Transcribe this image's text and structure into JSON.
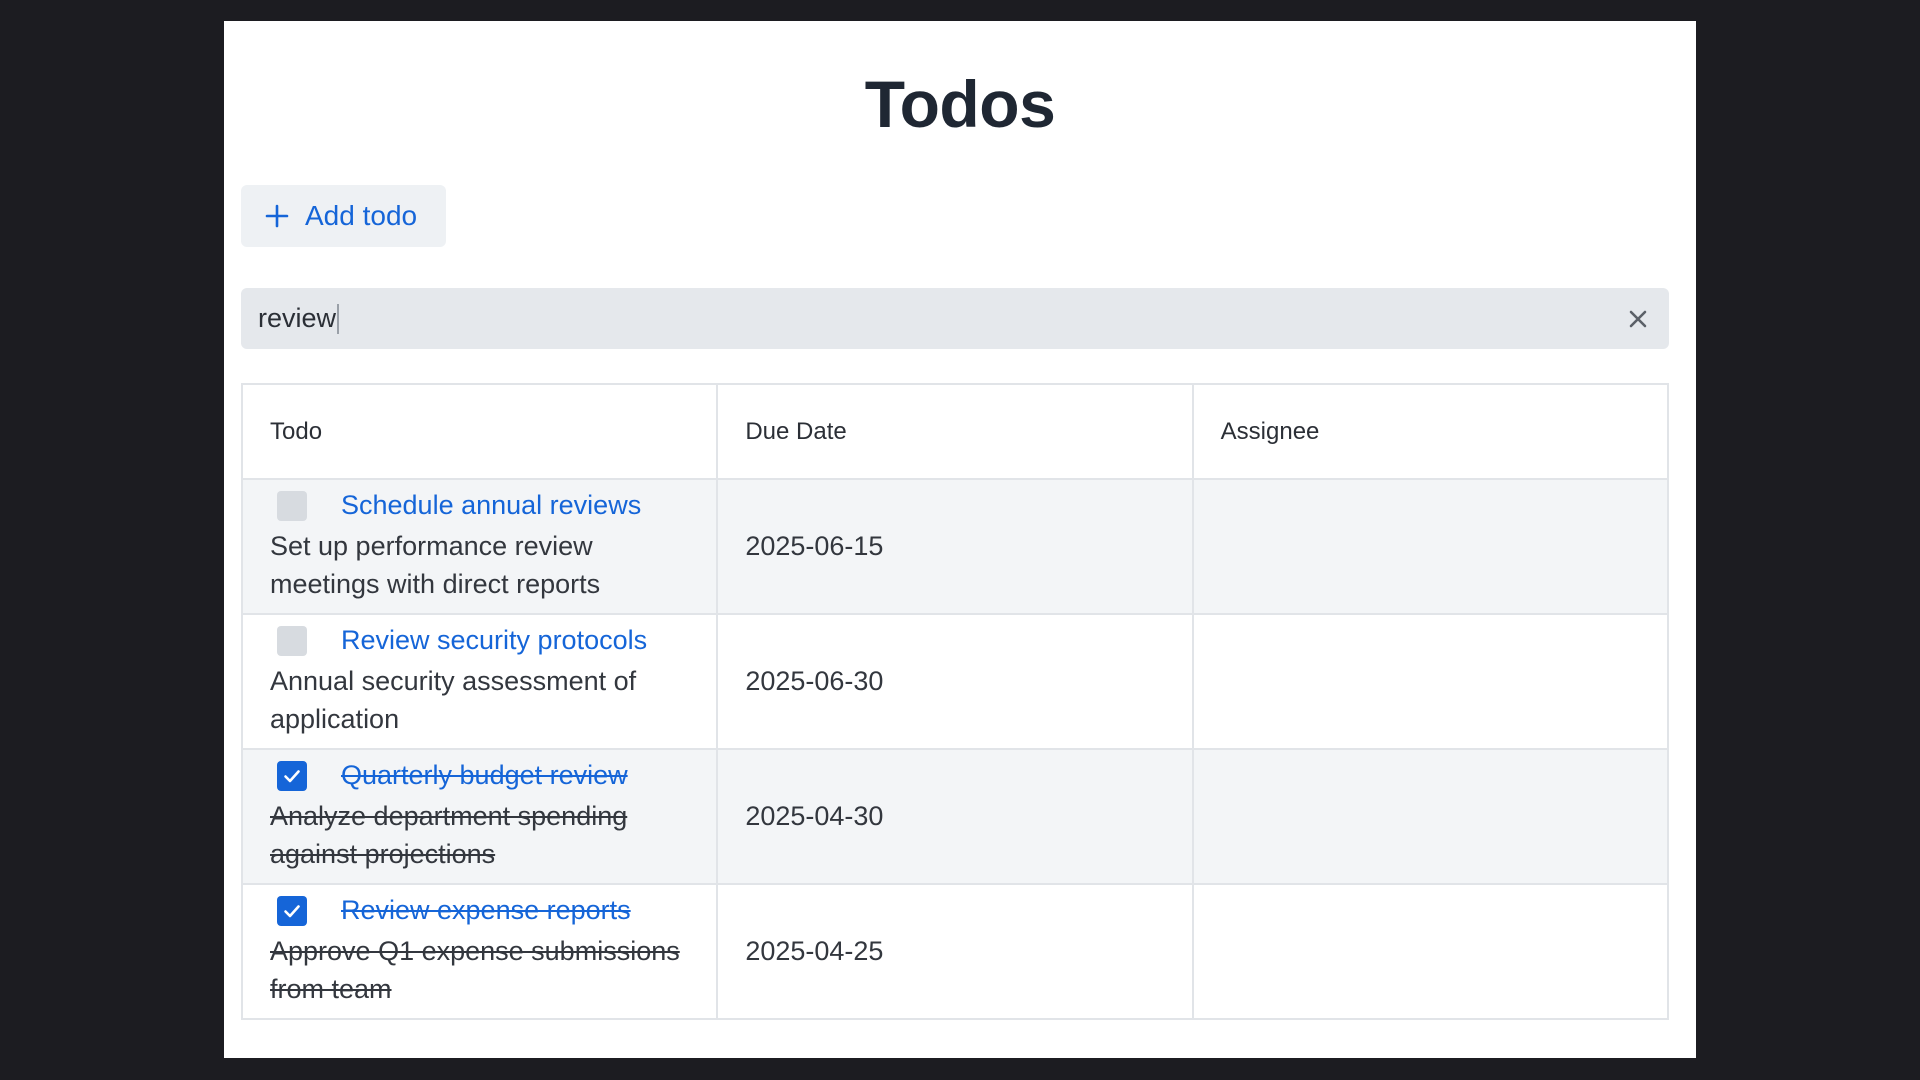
{
  "page": {
    "title": "Todos"
  },
  "toolbar": {
    "add_label": "Add todo"
  },
  "search": {
    "value": "review"
  },
  "table": {
    "columns": [
      "Todo",
      "Due Date",
      "Assignee"
    ],
    "rows": [
      {
        "title": "Schedule annual reviews",
        "description": "Set up performance review meetings with direct reports",
        "due": "2025-06-15",
        "assignee": "",
        "done": false
      },
      {
        "title": "Review security protocols",
        "description": "Annual security assessment of application",
        "due": "2025-06-30",
        "assignee": "",
        "done": false
      },
      {
        "title": "Quarterly budget review",
        "description": "Analyze department spending against projections",
        "due": "2025-04-30",
        "assignee": "",
        "done": true
      },
      {
        "title": "Review expense reports",
        "description": "Approve Q1 expense submissions from team",
        "due": "2025-04-25",
        "assignee": "",
        "done": true
      }
    ]
  },
  "icons": {
    "add": "plus-icon",
    "clear": "close-icon",
    "check": "checkmark-icon"
  },
  "colors": {
    "accent": "#1565d8",
    "background": "#1c1c21",
    "title": "#1f2733"
  }
}
